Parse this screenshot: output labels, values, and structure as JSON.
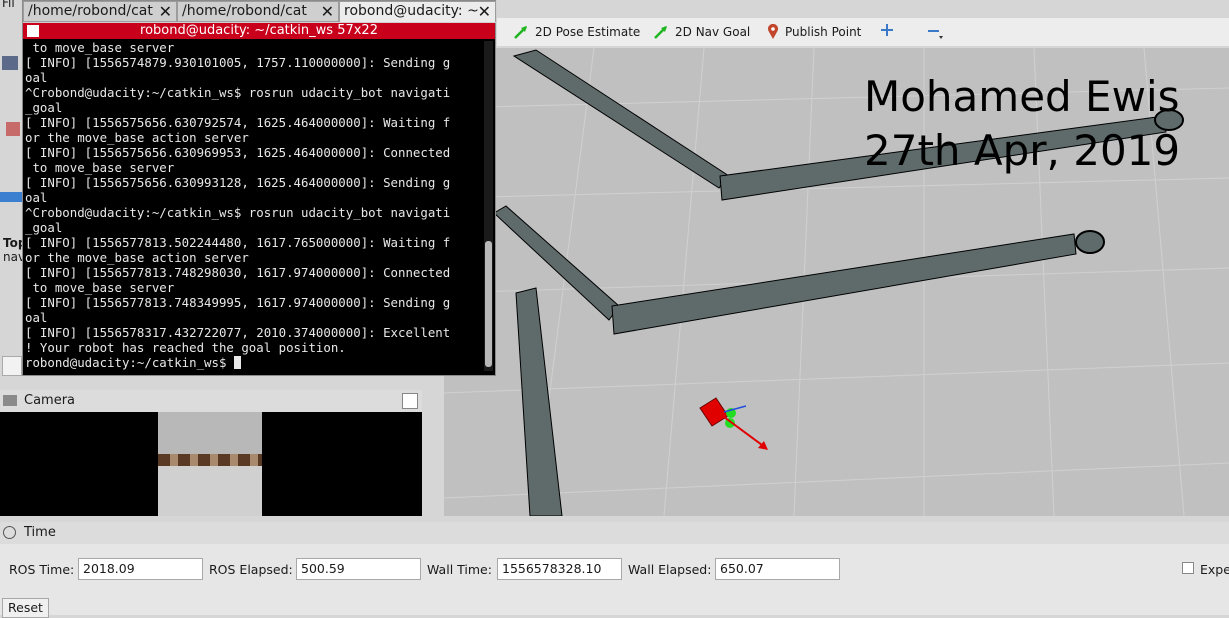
{
  "toolbar": {
    "pose_estimate": "2D Pose Estimate",
    "nav_goal": "2D Nav Goal",
    "publish_point": "Publish Point",
    "zoom_in_icon": "plus-icon",
    "zoom_out_icon": "minus-icon"
  },
  "viewport": {
    "overlay_name": "Mohamed Ewis",
    "overlay_date": "27th Apr, 2019"
  },
  "terminal": {
    "tabs": [
      {
        "label": "/home/robond/cat"
      },
      {
        "label": "/home/robond/cat"
      },
      {
        "label": "robond@udacity: ~"
      }
    ],
    "title": "robond@udacity: ~/catkin_ws 57x22",
    "lines": [
      " to move_base server",
      "[ INFO] [1556574879.930101005, 1757.110000000]: Sending g",
      "oal",
      "^Crobond@udacity:~/catkin_ws$ rosrun udacity_bot navigati",
      "_goal",
      "[ INFO] [1556575656.630792574, 1625.464000000]: Waiting f",
      "or the move_base action server",
      "[ INFO] [1556575656.630969953, 1625.464000000]: Connected",
      " to move_base server",
      "[ INFO] [1556575656.630993128, 1625.464000000]: Sending g",
      "oal",
      "^Crobond@udacity:~/catkin_ws$ rosrun udacity_bot navigati",
      "_goal",
      "[ INFO] [1556577813.502244480, 1617.765000000]: Waiting f",
      "or the move_base action server",
      "[ INFO] [1556577813.748298030, 1617.974000000]: Connected",
      " to move_base server",
      "[ INFO] [1556577813.748349995, 1617.974000000]: Sending g",
      "oal",
      "[ INFO] [1556578317.432722077, 2010.374000000]: Excellent",
      "! Your robot has reached the goal position."
    ],
    "prompt": "robond@udacity:~/catkin_ws$ "
  },
  "left_dock": {
    "menu_fragment": "Fil",
    "tool_fragment": "Top",
    "tool_fragment2": "nav"
  },
  "camera": {
    "title": "Camera"
  },
  "time": {
    "title": "Time",
    "ros_time_label": "ROS Time:",
    "ros_time": "2018.09",
    "ros_elapsed_label": "ROS Elapsed:",
    "ros_elapsed": "500.59",
    "wall_time_label": "Wall Time:",
    "wall_time": "1556578328.10",
    "wall_elapsed_label": "Wall Elapsed:",
    "wall_elapsed": "650.07",
    "experimental_label": "Expe",
    "reset_label": "Reset"
  },
  "colors": {
    "terminal_title_bg": "#c9001c",
    "wall": "#5f6a6a",
    "robot": "#e00000",
    "goal_arrow": "#e00000",
    "nav_goal_green": "#22cc22"
  }
}
